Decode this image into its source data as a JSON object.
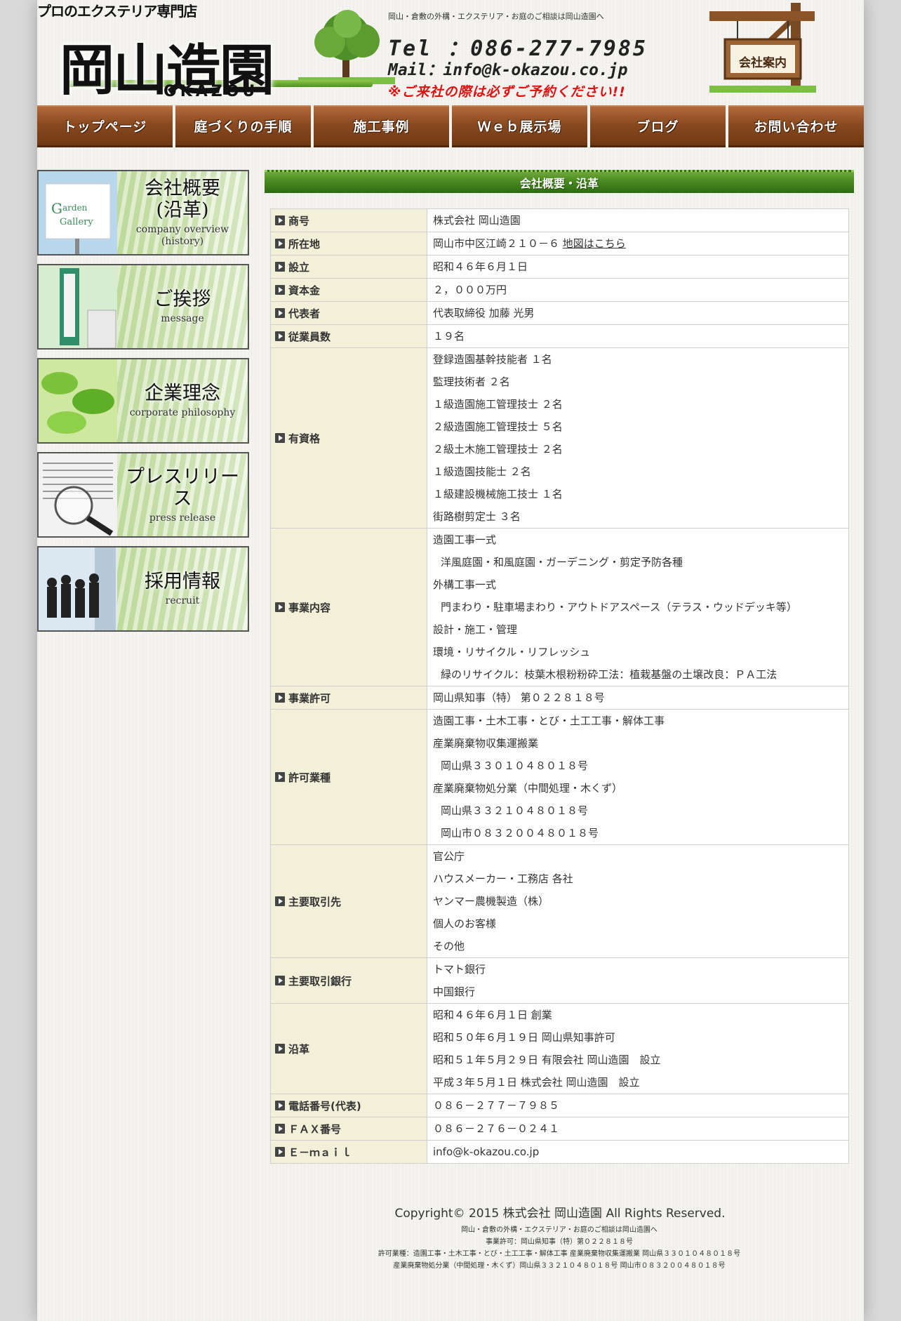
{
  "header": {
    "tagline": "プロのエクステリア専門店",
    "logo_text": "岡山造園",
    "logo_roman": "OKAZOU",
    "subtitle": "岡山・倉敷の外構・エクステリア・お庭のご相談は岡山造園へ",
    "tel": "Tel ：086-277-7985",
    "mail": "Mail：info@k-okazou.co.jp",
    "warning": "※ご来社の際は必ずご予約ください!!",
    "sign_label": "会社案内"
  },
  "nav": [
    {
      "label": "トップページ"
    },
    {
      "label": "庭づくりの手順"
    },
    {
      "label": "施工事例"
    },
    {
      "label": "Ｗｅｂ展示場"
    },
    {
      "label": "ブログ"
    },
    {
      "label": "お問い合わせ"
    }
  ],
  "sidebar": [
    {
      "title": "会社概要\n(沿革)",
      "sub": "company overview\n(history)",
      "photo": "garden-gallery-sign"
    },
    {
      "title": "ご挨拶",
      "sub": "message",
      "photo": "company-sign-post"
    },
    {
      "title": "企業理念",
      "sub": "corporate philosophy",
      "photo": "green-leaves"
    },
    {
      "title": "プレスリリース",
      "sub": "press release",
      "photo": "newspaper-magnifier"
    },
    {
      "title": "採用情報",
      "sub": "recruit",
      "photo": "business-people"
    }
  ],
  "main": {
    "section_title": "会社概要・沿革",
    "rows": [
      {
        "label": "商号",
        "lines": [
          {
            "t": "株式会社 岡山造園"
          }
        ]
      },
      {
        "label": "所在地",
        "lines": [
          {
            "t": "岡山市中区江崎２１０－６ ",
            "link": "地図はこちら"
          }
        ]
      },
      {
        "label": "設立",
        "lines": [
          {
            "t": "昭和４６年６月１日"
          }
        ]
      },
      {
        "label": "資本金",
        "lines": [
          {
            "t": "２，０００万円"
          }
        ]
      },
      {
        "label": "代表者",
        "lines": [
          {
            "t": "代表取締役 加藤 光男"
          }
        ]
      },
      {
        "label": "従業員数",
        "lines": [
          {
            "t": "１９名"
          }
        ]
      },
      {
        "label": "有資格",
        "lines": [
          {
            "t": "登録造園基幹技能者 １名"
          },
          {
            "t": "監理技術者 ２名"
          },
          {
            "t": "１級造園施工管理技士 ２名"
          },
          {
            "t": "２級造園施工管理技士 ５名"
          },
          {
            "t": "２級土木施工管理技士 ２名"
          },
          {
            "t": "１級造園技能士 ２名"
          },
          {
            "t": "１級建設機械施工技士 １名"
          },
          {
            "t": "街路樹剪定士 ３名"
          }
        ]
      },
      {
        "label": "事業内容",
        "lines": [
          {
            "t": "造園工事一式"
          },
          {
            "t": "洋風庭園・和風庭園・ガーデニング・剪定予防各種",
            "indent": true
          },
          {
            "t": "外構工事一式"
          },
          {
            "t": "門まわり・駐車場まわり・アウトドアスペース（テラス・ウッドデッキ等）",
            "indent": true
          },
          {
            "t": "設計・施工・管理"
          },
          {
            "t": "環境・リサイクル・リフレッシュ"
          },
          {
            "t": "緑のリサイクル：枝葉木根粉粉砕工法：植栽基盤の土壌改良：ＰＡ工法",
            "indent": true
          }
        ]
      },
      {
        "label": "事業許可",
        "lines": [
          {
            "t": "岡山県知事（特） 第０２２８１８号"
          }
        ]
      },
      {
        "label": "許可業種",
        "lines": [
          {
            "t": "造園工事・土木工事・とび・土工工事・解体工事"
          },
          {
            "t": "産業廃棄物収集運搬業"
          },
          {
            "t": "岡山県３３０１０４８０１８号",
            "indent": true
          },
          {
            "t": "産業廃棄物処分業（中間処理・木くず）"
          },
          {
            "t": "岡山県３３２１０４８０１８号",
            "indent": true
          },
          {
            "t": "岡山市０８３２００４８０１８号",
            "indent": true
          }
        ]
      },
      {
        "label": "主要取引先",
        "lines": [
          {
            "t": "官公庁"
          },
          {
            "t": "ハウスメーカー・工務店 各社"
          },
          {
            "t": "ヤンマー農機製造（株）"
          },
          {
            "t": "個人のお客様"
          },
          {
            "t": "その他"
          }
        ]
      },
      {
        "label": "主要取引銀行",
        "lines": [
          {
            "t": "トマト銀行"
          },
          {
            "t": "中国銀行"
          }
        ]
      },
      {
        "label": "沿革",
        "lines": [
          {
            "t": "昭和４６年６月１日 創業"
          },
          {
            "t": "昭和５０年６月１９日 岡山県知事許可"
          },
          {
            "t": "昭和５１年５月２９日 有限会社 岡山造園　設立"
          },
          {
            "t": "平成３年５月１日 株式会社 岡山造園　設立"
          }
        ]
      },
      {
        "label": "電話番号(代表)",
        "lines": [
          {
            "t": "０８６－２７７－７９８５"
          }
        ]
      },
      {
        "label": "ＦＡＸ番号",
        "lines": [
          {
            "t": "０８６－２７６－０２４１"
          }
        ]
      },
      {
        "label": "Ｅ－ｍａｉｌ",
        "lines": [
          {
            "t": "info@k-okazou.co.jp"
          }
        ]
      }
    ]
  },
  "footer": {
    "copyright": "Copyright© 2015 株式会社 岡山造園 All Rights Reserved.",
    "lines": [
      "岡山・倉敷の外構・エクステリア・お庭のご相談は岡山造園へ",
      "事業許可：岡山県知事（特）第０２２８１８号",
      "許可業種：造園工事・土木工事・とび・土工工事・解体工事 産業廃棄物収集運搬業 岡山県３３０１０４８０１８号",
      "産業廃棄物処分業（中間処理・木くず）岡山県３３２１０４８０１８号 岡山市０８３２００４８０１８号"
    ]
  },
  "colors": {
    "nav_wood": "#8a4a20",
    "section_green": "#4c8c22",
    "label_bg": "#f2f0d8",
    "warning_red": "#d11111"
  }
}
